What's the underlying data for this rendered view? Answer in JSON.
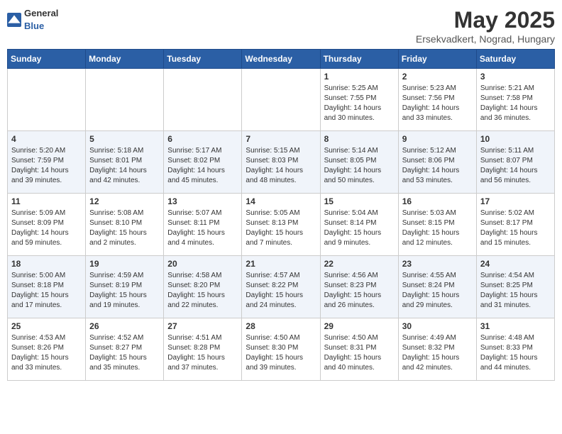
{
  "header": {
    "logo_general": "General",
    "logo_blue": "Blue",
    "title": "May 2025",
    "subtitle": "Ersekvadkert, Nograd, Hungary"
  },
  "days_of_week": [
    "Sunday",
    "Monday",
    "Tuesday",
    "Wednesday",
    "Thursday",
    "Friday",
    "Saturday"
  ],
  "weeks": [
    {
      "cells": [
        {
          "day": "",
          "content": ""
        },
        {
          "day": "",
          "content": ""
        },
        {
          "day": "",
          "content": ""
        },
        {
          "day": "",
          "content": ""
        },
        {
          "day": "1",
          "content": "Sunrise: 5:25 AM\nSunset: 7:55 PM\nDaylight: 14 hours\nand 30 minutes."
        },
        {
          "day": "2",
          "content": "Sunrise: 5:23 AM\nSunset: 7:56 PM\nDaylight: 14 hours\nand 33 minutes."
        },
        {
          "day": "3",
          "content": "Sunrise: 5:21 AM\nSunset: 7:58 PM\nDaylight: 14 hours\nand 36 minutes."
        }
      ]
    },
    {
      "cells": [
        {
          "day": "4",
          "content": "Sunrise: 5:20 AM\nSunset: 7:59 PM\nDaylight: 14 hours\nand 39 minutes."
        },
        {
          "day": "5",
          "content": "Sunrise: 5:18 AM\nSunset: 8:01 PM\nDaylight: 14 hours\nand 42 minutes."
        },
        {
          "day": "6",
          "content": "Sunrise: 5:17 AM\nSunset: 8:02 PM\nDaylight: 14 hours\nand 45 minutes."
        },
        {
          "day": "7",
          "content": "Sunrise: 5:15 AM\nSunset: 8:03 PM\nDaylight: 14 hours\nand 48 minutes."
        },
        {
          "day": "8",
          "content": "Sunrise: 5:14 AM\nSunset: 8:05 PM\nDaylight: 14 hours\nand 50 minutes."
        },
        {
          "day": "9",
          "content": "Sunrise: 5:12 AM\nSunset: 8:06 PM\nDaylight: 14 hours\nand 53 minutes."
        },
        {
          "day": "10",
          "content": "Sunrise: 5:11 AM\nSunset: 8:07 PM\nDaylight: 14 hours\nand 56 minutes."
        }
      ]
    },
    {
      "cells": [
        {
          "day": "11",
          "content": "Sunrise: 5:09 AM\nSunset: 8:09 PM\nDaylight: 14 hours\nand 59 minutes."
        },
        {
          "day": "12",
          "content": "Sunrise: 5:08 AM\nSunset: 8:10 PM\nDaylight: 15 hours\nand 2 minutes."
        },
        {
          "day": "13",
          "content": "Sunrise: 5:07 AM\nSunset: 8:11 PM\nDaylight: 15 hours\nand 4 minutes."
        },
        {
          "day": "14",
          "content": "Sunrise: 5:05 AM\nSunset: 8:13 PM\nDaylight: 15 hours\nand 7 minutes."
        },
        {
          "day": "15",
          "content": "Sunrise: 5:04 AM\nSunset: 8:14 PM\nDaylight: 15 hours\nand 9 minutes."
        },
        {
          "day": "16",
          "content": "Sunrise: 5:03 AM\nSunset: 8:15 PM\nDaylight: 15 hours\nand 12 minutes."
        },
        {
          "day": "17",
          "content": "Sunrise: 5:02 AM\nSunset: 8:17 PM\nDaylight: 15 hours\nand 15 minutes."
        }
      ]
    },
    {
      "cells": [
        {
          "day": "18",
          "content": "Sunrise: 5:00 AM\nSunset: 8:18 PM\nDaylight: 15 hours\nand 17 minutes."
        },
        {
          "day": "19",
          "content": "Sunrise: 4:59 AM\nSunset: 8:19 PM\nDaylight: 15 hours\nand 19 minutes."
        },
        {
          "day": "20",
          "content": "Sunrise: 4:58 AM\nSunset: 8:20 PM\nDaylight: 15 hours\nand 22 minutes."
        },
        {
          "day": "21",
          "content": "Sunrise: 4:57 AM\nSunset: 8:22 PM\nDaylight: 15 hours\nand 24 minutes."
        },
        {
          "day": "22",
          "content": "Sunrise: 4:56 AM\nSunset: 8:23 PM\nDaylight: 15 hours\nand 26 minutes."
        },
        {
          "day": "23",
          "content": "Sunrise: 4:55 AM\nSunset: 8:24 PM\nDaylight: 15 hours\nand 29 minutes."
        },
        {
          "day": "24",
          "content": "Sunrise: 4:54 AM\nSunset: 8:25 PM\nDaylight: 15 hours\nand 31 minutes."
        }
      ]
    },
    {
      "cells": [
        {
          "day": "25",
          "content": "Sunrise: 4:53 AM\nSunset: 8:26 PM\nDaylight: 15 hours\nand 33 minutes."
        },
        {
          "day": "26",
          "content": "Sunrise: 4:52 AM\nSunset: 8:27 PM\nDaylight: 15 hours\nand 35 minutes."
        },
        {
          "day": "27",
          "content": "Sunrise: 4:51 AM\nSunset: 8:28 PM\nDaylight: 15 hours\nand 37 minutes."
        },
        {
          "day": "28",
          "content": "Sunrise: 4:50 AM\nSunset: 8:30 PM\nDaylight: 15 hours\nand 39 minutes."
        },
        {
          "day": "29",
          "content": "Sunrise: 4:50 AM\nSunset: 8:31 PM\nDaylight: 15 hours\nand 40 minutes."
        },
        {
          "day": "30",
          "content": "Sunrise: 4:49 AM\nSunset: 8:32 PM\nDaylight: 15 hours\nand 42 minutes."
        },
        {
          "day": "31",
          "content": "Sunrise: 4:48 AM\nSunset: 8:33 PM\nDaylight: 15 hours\nand 44 minutes."
        }
      ]
    }
  ]
}
